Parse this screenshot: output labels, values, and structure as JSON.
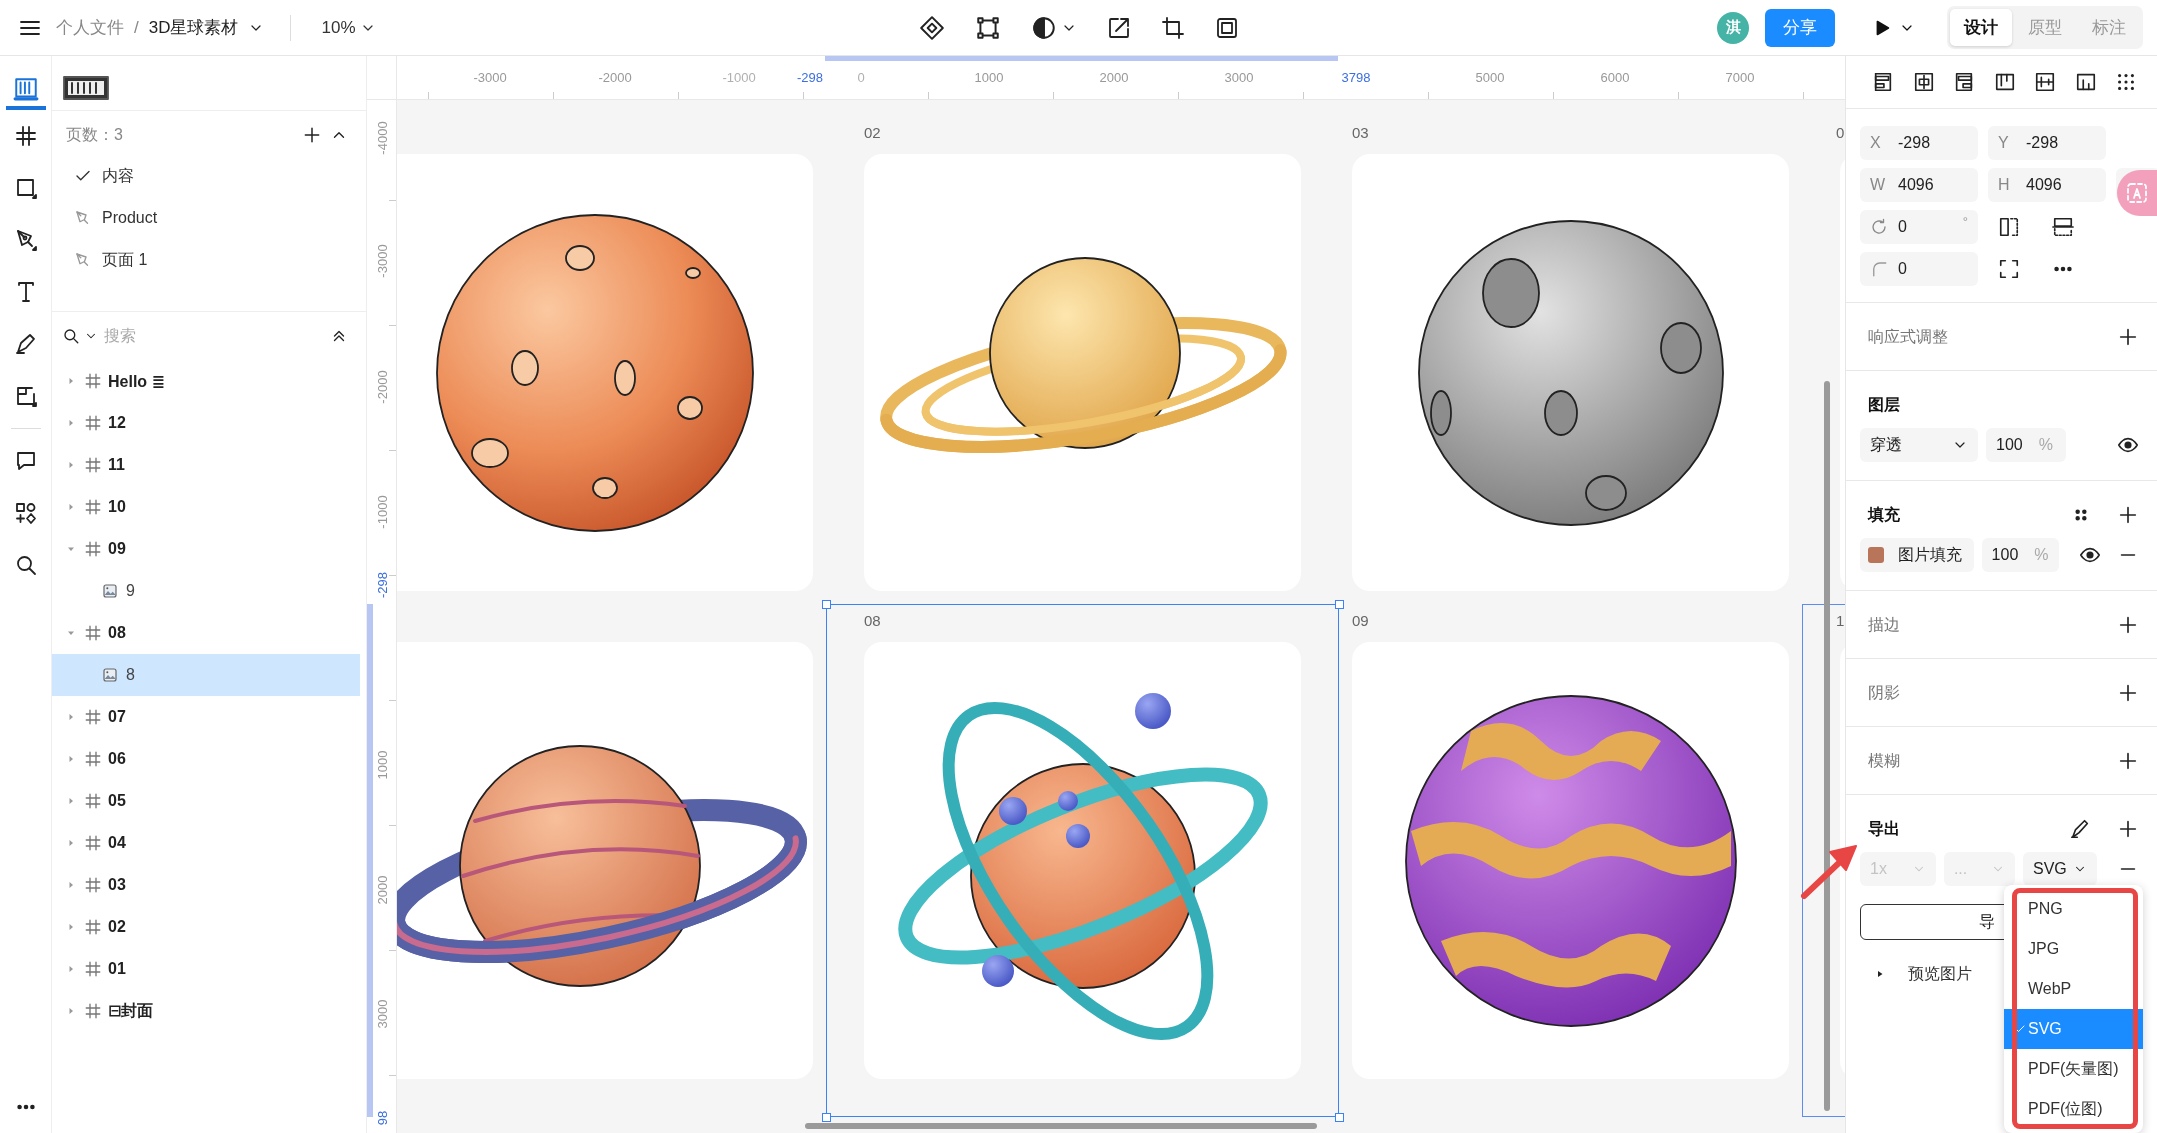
{
  "topbar": {
    "breadcrumb": [
      {
        "text": "个人文件",
        "kind": "parent"
      },
      {
        "text": "/",
        "kind": "separator"
      },
      {
        "text": "3D星球素材",
        "kind": "current"
      }
    ],
    "zoom": "10%",
    "avatar": "淇",
    "share": "分享",
    "mode_tabs": [
      {
        "label": "设计",
        "selected": true
      },
      {
        "label": "原型",
        "selected": false
      },
      {
        "label": "标注",
        "selected": false
      }
    ]
  },
  "side_tabs": [
    {
      "selected": true
    },
    {
      "selected": false
    }
  ],
  "pages": {
    "title": "页数：3",
    "items": [
      {
        "name": "内容",
        "selected": true
      },
      {
        "name": "Product",
        "selected": false
      },
      {
        "name": "页面 1",
        "selected": false
      }
    ]
  },
  "layers": {
    "search": {
      "placeholder": "搜索"
    },
    "items": [
      {
        "name": "Hello ≣",
        "kind": "frame",
        "expanded": false,
        "selected": false
      },
      {
        "name": "12",
        "kind": "frame",
        "expanded": false,
        "selected": false
      },
      {
        "name": "11",
        "kind": "frame",
        "expanded": false,
        "selected": false
      },
      {
        "name": "10",
        "kind": "frame",
        "expanded": false,
        "selected": false
      },
      {
        "name": "09",
        "kind": "frame",
        "expanded": true,
        "selected": false,
        "children": [
          {
            "name": "9",
            "kind": "image",
            "selected": false
          }
        ]
      },
      {
        "name": "08",
        "kind": "frame",
        "expanded": true,
        "selected": false,
        "children": [
          {
            "name": "8",
            "kind": "image",
            "selected": true
          }
        ]
      },
      {
        "name": "07",
        "kind": "frame",
        "expanded": false,
        "selected": false
      },
      {
        "name": "06",
        "kind": "frame",
        "expanded": false,
        "selected": false
      },
      {
        "name": "05",
        "kind": "frame",
        "expanded": false,
        "selected": false
      },
      {
        "name": "04",
        "kind": "frame",
        "expanded": false,
        "selected": false
      },
      {
        "name": "03",
        "kind": "frame",
        "expanded": false,
        "selected": false
      },
      {
        "name": "02",
        "kind": "frame",
        "expanded": false,
        "selected": false
      },
      {
        "name": "01",
        "kind": "frame",
        "expanded": false,
        "selected": false
      },
      {
        "name": "⊟封面",
        "kind": "frame",
        "expanded": false,
        "selected": false
      }
    ]
  },
  "canvas": {
    "ruler_top": [
      {
        "label": "-3000",
        "kind": "tick"
      },
      {
        "label": "-2000",
        "kind": "tick"
      },
      {
        "label": "-1000",
        "kind": "faint"
      },
      {
        "label": "-298",
        "kind": "marker"
      },
      {
        "label": "0",
        "kind": "faint"
      },
      {
        "label": "1000",
        "kind": "tick"
      },
      {
        "label": "2000",
        "kind": "tick"
      },
      {
        "label": "3000",
        "kind": "tick"
      },
      {
        "label": "3798",
        "kind": "marker"
      },
      {
        "label": "5000",
        "kind": "tick"
      },
      {
        "label": "6000",
        "kind": "tick"
      },
      {
        "label": "7000",
        "kind": "tick"
      }
    ],
    "ruler_left": [
      {
        "label": "-4000",
        "kind": "tick"
      },
      {
        "label": "-3000",
        "kind": "tick"
      },
      {
        "label": "-2000",
        "kind": "tick"
      },
      {
        "label": "-1000",
        "kind": "tick"
      },
      {
        "label": "-298",
        "kind": "marker"
      },
      {
        "label": "1000",
        "kind": "tick"
      },
      {
        "label": "2000",
        "kind": "tick"
      },
      {
        "label": "3000",
        "kind": "tick"
      },
      {
        "label": "98",
        "kind": "marker"
      }
    ],
    "frames": [
      {
        "kind": "spotted",
        "selected": false,
        "hovered": false
      },
      {
        "label": "02",
        "kind": "ringed",
        "selected": false,
        "hovered": false
      },
      {
        "label": "03",
        "kind": "cratered",
        "selected": false,
        "hovered": false
      },
      {
        "label": "0",
        "kind": "blank",
        "selected": false,
        "hovered": false
      },
      {
        "kind": "banded",
        "selected": false,
        "hovered": false
      },
      {
        "label": "08",
        "kind": "orbit",
        "selected": true,
        "hovered": false
      },
      {
        "label": "09",
        "kind": "swirl",
        "selected": false,
        "hovered": false
      },
      {
        "label": "1",
        "kind": "blank",
        "selected": false,
        "hovered": true
      }
    ]
  },
  "inspector": {
    "fields": [
      {
        "label": "X",
        "value": "-298"
      },
      {
        "label": "Y",
        "value": "-298"
      },
      {
        "label": "W",
        "value": "4096"
      },
      {
        "label": "H",
        "value": "4096"
      }
    ],
    "rotation": "0",
    "rotation_unit": "°",
    "radius": "0",
    "sections": [
      {
        "title": "响应式调整",
        "kind": "empty"
      },
      {
        "title": "图层",
        "kind": "layer",
        "blend": "穿透",
        "opacity": "100",
        "unit": "%",
        "visible": true
      },
      {
        "title": "填充",
        "kind": "fill",
        "fill_name": "图片填充",
        "opacity": "100",
        "unit": "%",
        "visible": true
      },
      {
        "title": "描边",
        "kind": "empty"
      },
      {
        "title": "阴影",
        "kind": "empty"
      },
      {
        "title": "模糊",
        "kind": "empty"
      },
      {
        "title": "导出",
        "kind": "export",
        "scale": "1x",
        "suffix": "...",
        "format": "SVG",
        "button": "导",
        "preview": "预览图片"
      }
    ]
  },
  "export_menu": {
    "items": [
      {
        "label": "PNG",
        "selected": false
      },
      {
        "label": "JPG",
        "selected": false
      },
      {
        "label": "WebP",
        "selected": false
      },
      {
        "label": "SVG",
        "selected": true
      },
      {
        "label": "PDF(矢量图)",
        "selected": false
      },
      {
        "label": "PDF(位图)",
        "selected": false
      }
    ]
  }
}
